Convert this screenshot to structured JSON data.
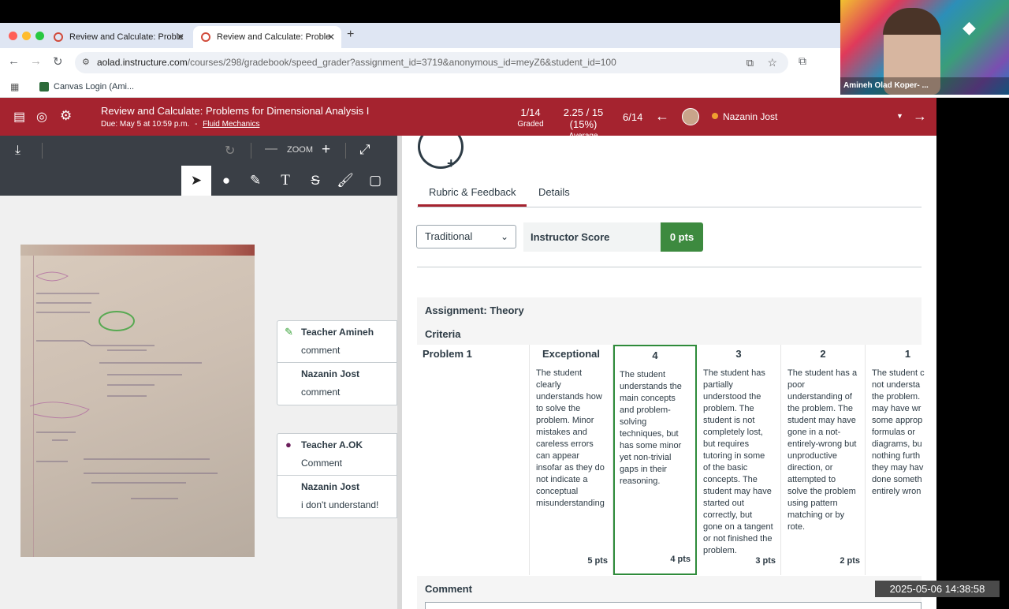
{
  "browser": {
    "tabs": [
      {
        "label": "Review and Calculate: Proble"
      },
      {
        "label": "Review and Calculate: Proble"
      }
    ],
    "url_host": "aolad.instructure.com",
    "url_path": "/courses/298/gradebook/speed_grader?assignment_id=3719&anonymous_id=meyZ6&student_id=100",
    "bookmark": "Canvas Login (Ami..."
  },
  "video": {
    "name": "Amineh Olad Koper- ..."
  },
  "header": {
    "title": "Review and Calculate: Problems for Dimensional Analysis I",
    "due": "Due: May 5 at 10:59 p.m.",
    "separator": "-",
    "course": "Fluid Mechanics",
    "graded_count": "1/14",
    "graded_label": "Graded",
    "average_value": "2.25 / 15 (15%)",
    "average_label": "Average",
    "student_position": "6/14",
    "student_name": "Nazanin Jost"
  },
  "doc_toolbar": {
    "zoom_label": "ZOOM"
  },
  "comments": [
    {
      "author": "Teacher Amineh",
      "text": "comment",
      "reply_author": "Nazanin Jost",
      "reply_text": "comment"
    },
    {
      "author": "Teacher A.OK",
      "text": "Comment",
      "reply_author": "Nazanin Jost",
      "reply_text": "i don't understand!"
    }
  ],
  "tabs": {
    "rubric": "Rubric & Feedback",
    "details": "Details"
  },
  "grading": {
    "mode": "Traditional",
    "score_label": "Instructor Score",
    "score_value": "0 pts"
  },
  "rubric": {
    "assignment": "Assignment: Theory",
    "criteria_label": "Criteria",
    "criterion": "Problem 1",
    "ratings": [
      {
        "title": "Exceptional",
        "desc": "The student\nclearly\nunderstands how\nto solve the\nproblem. Minor\nmistakes and\ncareless errors\ncan appear\ninsofar as they do\nnot indicate a\nconceptual\nmisunderstanding",
        "points": "5 pts"
      },
      {
        "title": "4",
        "desc": "The student\nunderstands the\nmain concepts\nand problem-\nsolving\ntechniques, but\nhas some minor\nyet non-trivial\ngaps in their\nreasoning.",
        "points": "4 pts"
      },
      {
        "title": "3",
        "desc": "The student has\npartially\nunderstood the\nproblem. The\nstudent is not\ncompletely lost,\nbut requires\ntutoring in some\nof the basic\nconcepts. The\nstudent may have\nstarted out\ncorrectly, but\ngone on a tangent\nor not finished the\nproblem.",
        "points": "3 pts"
      },
      {
        "title": "2",
        "desc": "The student has a\npoor\nunderstanding of\nthe problem. The\nstudent may have\ngone in a not-\nentirely-wrong but\nunproductive\ndirection, or\nattempted to\nsolve the problem\nusing pattern\nmatching or by\nrote.",
        "points": "2 pts"
      },
      {
        "title": "1",
        "desc": "The student c\nnot understa\nthe problem.\nmay have wr\nsome approp\nformulas or\ndiagrams, bu\nnothing furth\nthey may hav\ndone someth\nentirely wron",
        "points": ""
      }
    ],
    "comment_label": "Comment"
  },
  "timestamp": "2025-05-06 14:38:58",
  "colors": {
    "canvas_red": "#a5232f",
    "score_green": "#3d8a3f",
    "selected_border": "#2e8b3a"
  }
}
